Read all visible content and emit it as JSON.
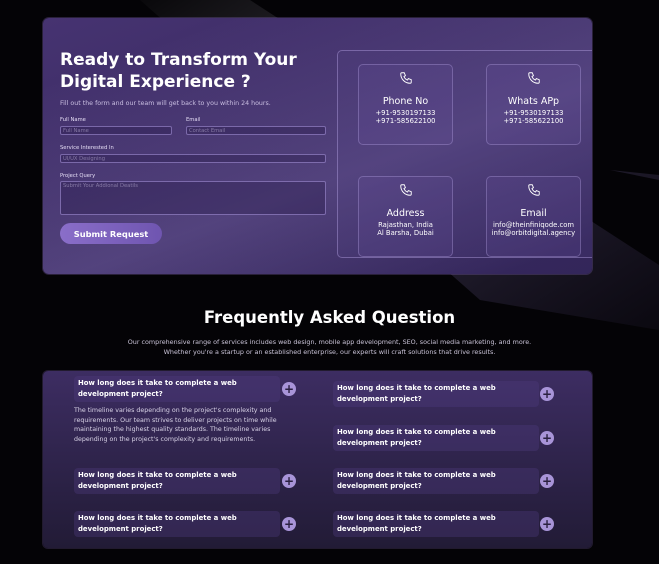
{
  "contact": {
    "title": "Ready to Transform Your Digital Experience ?",
    "subtitle": "Fill out the form and our team will get back to you within 24 hours.",
    "form": {
      "full_name": {
        "label": "Full Name",
        "placeholder": "Full Name"
      },
      "email": {
        "label": "Email",
        "placeholder": "Contact Email"
      },
      "service": {
        "label": "Service Interested In",
        "placeholder": "UI/UX Designing"
      },
      "query": {
        "label": "Project Query",
        "placeholder": "Submit Your Addional Deatils"
      },
      "submit_label": "Submit Request"
    },
    "info": {
      "phone": {
        "title": "Phone No",
        "lines": [
          "+91-9530197133",
          "+971-585622100"
        ],
        "icon": "phone-icon"
      },
      "whatsapp": {
        "title": "Whats APp",
        "lines": [
          "+91-9530197133",
          "+971-585622100"
        ],
        "icon": "phone-icon"
      },
      "address": {
        "title": "Address",
        "lines": [
          "Rajasthan, India",
          "Al Barsha, Dubai"
        ],
        "icon": "phone-icon"
      },
      "email": {
        "title": "Email",
        "lines": [
          "info@theinfiniqode.com",
          "info@orbitdigital.agency"
        ],
        "icon": "phone-icon"
      }
    }
  },
  "faq": {
    "title": "Frequently Asked Question",
    "description": "Our comprehensive range of services includes web design, mobile app development, SEO, social media marketing, and more. Whether you're a startup or an established enterprise, our experts will craft solutions that drive results.",
    "items": [
      {
        "question": "How long does it take to complete a web development project?"
      },
      {
        "question": "How long does it take to complete a web development project?"
      },
      {
        "question": "How long does it take to complete a web development project?"
      },
      {
        "question": "How long does it take to complete a web development project?"
      },
      {
        "question": "How long does it take to complete a web development project?"
      },
      {
        "question": "How long does it take to complete a web development project?"
      },
      {
        "question": "How long does it take to complete a web development project?"
      }
    ],
    "open_answer": "The timeline varies depending on the project's complexity and requirements. Our team strives to deliver projects on time while maintaining the highest quality standards. The timeline varies depending on the project's complexity and requirements.",
    "toggle_symbol": "+"
  },
  "colors": {
    "background": "#040306",
    "card": "#3f2e69",
    "accent": "#7a60bd"
  }
}
